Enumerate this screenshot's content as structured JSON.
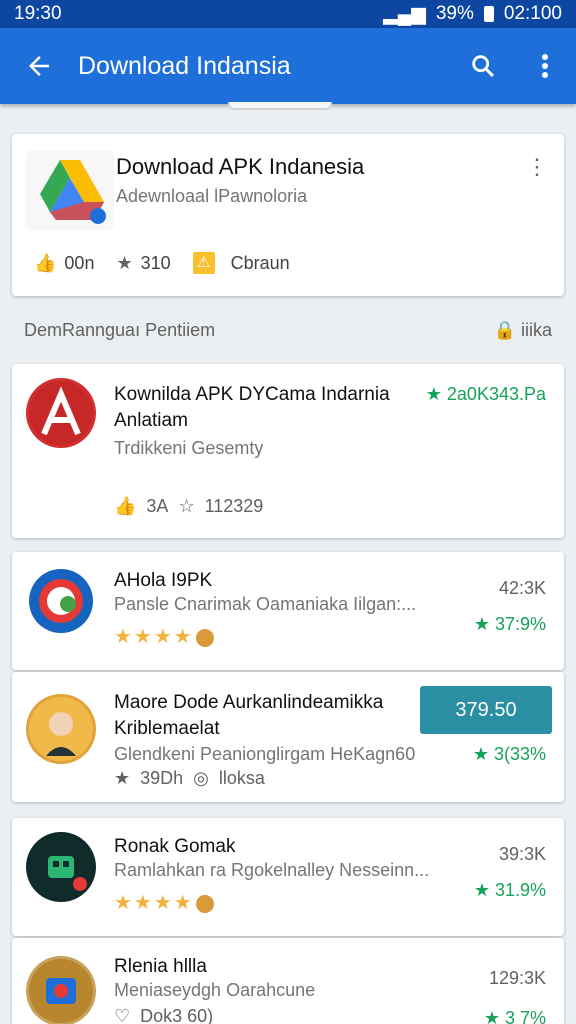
{
  "status": {
    "time": "19:30",
    "battery": "39%",
    "clock": "02:100"
  },
  "appbar": {
    "title": "Download Indansia"
  },
  "hero": {
    "title": "Download APK Indanesia",
    "subtitle": "Adewnloaal lPawnoloria",
    "likes": "00n",
    "rating": "310",
    "badge_label": "Cbraun"
  },
  "section": {
    "title": "DemRannguaı Pentiiem",
    "action": "iiika"
  },
  "items": [
    {
      "name_line1": "Kownilda APK DYCama Indarnia",
      "name_line2": "Anlatiam",
      "subtitle": "Trdikkeni Gesemty",
      "score": "2a0K343.Pa",
      "likes": "3A",
      "stars": "112329"
    },
    {
      "name": "AHola I9PK",
      "subtitle": "Pansle Cnarimak Oamaniaka Iilgan:...",
      "count": "42:3K",
      "score": "37:9%"
    },
    {
      "name_line1": "Maore Dode Aurkanlindeamikka",
      "name_line2": "Kriblemaelat",
      "subtitle": "Glendkeni Peanionglirgam HeKagn60",
      "button": "379.50",
      "score": "3(33%",
      "rating": "39Dh",
      "views": "lloksa"
    },
    {
      "name": "Ronak Gomak",
      "subtitle": "Ramlahkan ra Rgokelnalley Nesseinn...",
      "count": "39:3K",
      "score": "31.9%"
    },
    {
      "name": "Rlenia hllla",
      "subtitle": "Meniaseydgh Oarahcune",
      "count": "129:3K",
      "meta": "Dok3 60)",
      "score": "3 7%"
    }
  ],
  "colors": {
    "appbar": "#1e6fd9",
    "statusbar": "#0d47a1",
    "accent_green": "#17a25a",
    "button_teal": "#2b8fa3",
    "star": "#f2b33d"
  }
}
